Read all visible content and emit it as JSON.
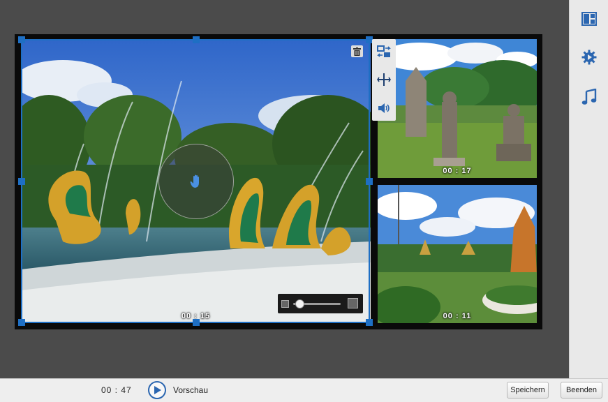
{
  "collage": {
    "tiles": [
      {
        "duration": "00 : 15"
      },
      {
        "duration": "00 : 17"
      },
      {
        "duration": "00 : 11"
      }
    ],
    "zoom_level": 0.05
  },
  "side_panel": {
    "icons": [
      "layout-icon",
      "gear-icon",
      "music-note-icon"
    ]
  },
  "tile_tools": {
    "icons": [
      "swap-icon",
      "fit-icon",
      "volume-icon"
    ]
  },
  "bottom_bar": {
    "total_duration": "00 : 47",
    "preview_label": "Vorschau",
    "save_label": "Speichern",
    "quit_label": "Beenden"
  },
  "colors": {
    "accent": "#1e6fc4",
    "workspace": "#4b4b4b",
    "panel": "#e9e9e9"
  }
}
